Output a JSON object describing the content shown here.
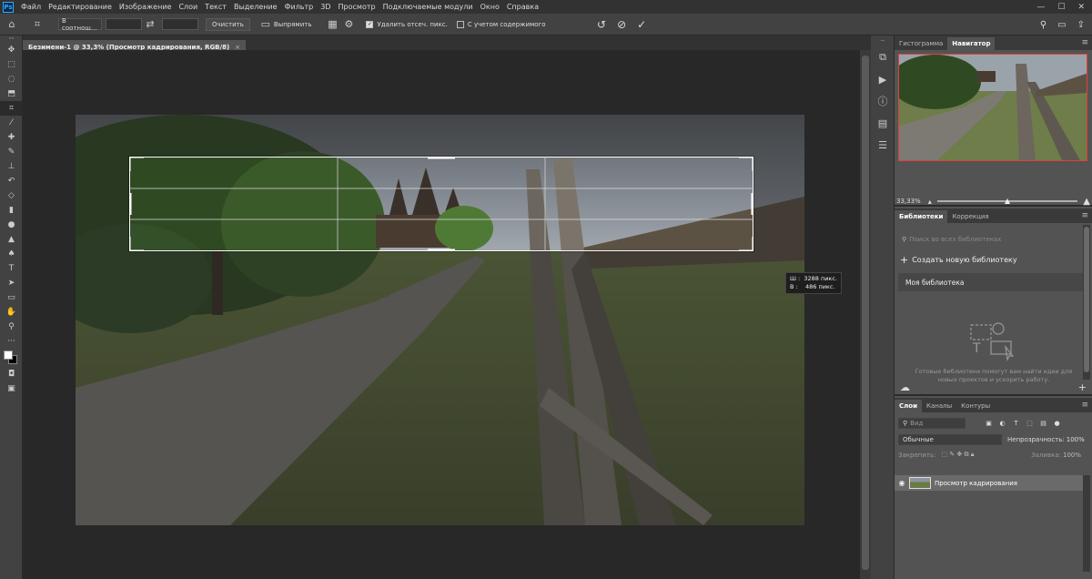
{
  "menubar": {
    "logo": "Ps",
    "items": [
      "Файл",
      "Редактирование",
      "Изображение",
      "Слои",
      "Текст",
      "Выделение",
      "Фильтр",
      "3D",
      "Просмотр",
      "Подключаемые модули",
      "Окно",
      "Справка"
    ],
    "controls": [
      "—",
      "☐",
      "✕"
    ]
  },
  "options": {
    "ratio_value": "В соотнош...",
    "clear_label": "Очистить",
    "straighten_label": "Выпрямить",
    "delete_cropped_label": "Удалить отсеч. пикс.",
    "delete_cropped_checked": true,
    "content_aware_label": "С учетом содержимого",
    "content_aware_checked": false
  },
  "document": {
    "tab_title": "Безимени-1 @ 33,3% (Просмотр кадрирования, RGB/8)",
    "close": "×"
  },
  "crop_readout": {
    "width": "Ш :  3288 пикс.",
    "height": "В :    486 пикс."
  },
  "panels": {
    "top_tabs": [
      "Гистограмма",
      "Навигатор"
    ],
    "top_active": 1,
    "zoom": "33,33%",
    "lib_tabs": [
      "Библиотеки",
      "Коррекция"
    ],
    "lib_active": 0,
    "lib_search_placeholder": "Поиск во всех библиотеках",
    "lib_create": "Создать новую библиотеку",
    "lib_item": "Моя библиотека",
    "lib_text": "Готовые библиотеки помогут вам найти идеи для новых проектов и ускорить работу.",
    "layer_tabs": [
      "Слои",
      "Каналы",
      "Контуры"
    ],
    "layer_active": 0,
    "layer_filter_placeholder": "Вид",
    "blend_mode": "Обычные",
    "opacity_label": "Непрозрачность:",
    "opacity_value": "100%",
    "lock_label": "Закрепить:",
    "fill_label": "Заливка:",
    "fill_value": "100%",
    "layer_name": "Просмотр кадрирования"
  },
  "colors": {
    "accent_selection": "#e0413a",
    "app_bg": "#535353",
    "canvas_bg": "#282828"
  }
}
